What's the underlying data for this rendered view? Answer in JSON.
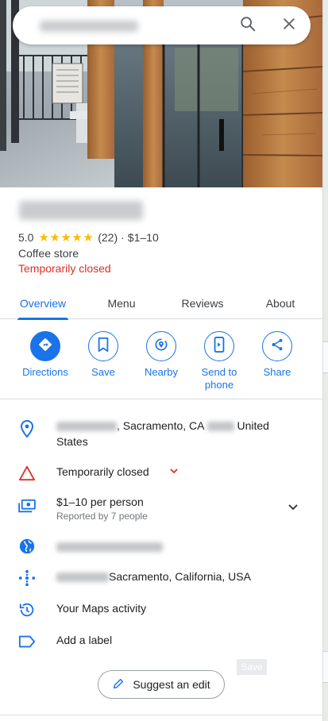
{
  "search": {
    "query": "",
    "placeholder": ""
  },
  "place": {
    "rating": "5.0",
    "stars": "★★★★★",
    "review_count": "(22)",
    "separator": "·",
    "price": "$1–10",
    "category": "Coffee store",
    "status": "Temporarily closed"
  },
  "tabs": [
    {
      "label": "Overview",
      "active": true
    },
    {
      "label": "Menu",
      "active": false
    },
    {
      "label": "Reviews",
      "active": false
    },
    {
      "label": "About",
      "active": false
    }
  ],
  "actions": [
    {
      "label": "Directions",
      "icon": "directions-icon"
    },
    {
      "label": "Save",
      "icon": "bookmark-icon"
    },
    {
      "label": "Nearby",
      "icon": "nearby-icon"
    },
    {
      "label": "Send to\nphone",
      "icon": "send-to-phone-icon"
    },
    {
      "label": "Share",
      "icon": "share-icon"
    }
  ],
  "details": {
    "address_part1": ", Sacramento, CA",
    "address_part2": " United",
    "address_part3": "States",
    "status": "Temporarily closed",
    "price_line": "$1–10 per person",
    "price_sub": "Reported by 7 people",
    "plus_code_suffix": "Sacramento, California, USA",
    "maps_activity": "Your Maps activity",
    "add_label": "Add a label"
  },
  "save_ghost": "Save",
  "suggest_edit": "Suggest an edit",
  "colors": {
    "accent": "#1a73e8",
    "danger": "#d93025",
    "star": "#fbbc04",
    "muted_text": "#70757a",
    "divider": "#dadce0"
  }
}
